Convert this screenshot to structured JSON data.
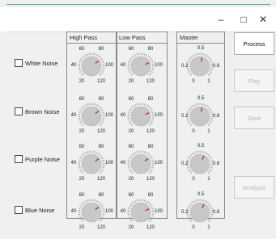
{
  "window": {
    "controls": {
      "minimize": "–",
      "maximize": "□",
      "close": "✕"
    }
  },
  "groups": {
    "highpass": "High Pass",
    "lowpass": "Low Pass",
    "master": "Master"
  },
  "noises": [
    {
      "label": "White Noise",
      "checked": false
    },
    {
      "label": "Brown Noise",
      "checked": false
    },
    {
      "label": "Purple Noise",
      "checked": false
    },
    {
      "label": "Blue Noise",
      "checked": false
    }
  ],
  "freq_ticks": {
    "a": "60",
    "b": "80",
    "c": "40",
    "d": "100",
    "e": "20",
    "f": "120"
  },
  "master_ticks": {
    "a": "0.5",
    "b": "0.2",
    "c": "0.8",
    "d": "0",
    "e": "1"
  },
  "knob_values": {
    "highpass": [
      90,
      90,
      90,
      90
    ],
    "lowpass": [
      95,
      95,
      90,
      95
    ],
    "master": [
      0.55,
      0.55,
      0.6,
      0.6
    ]
  },
  "buttons": {
    "process": "Process",
    "play": "Play",
    "save": "Save",
    "analysis": "Analysis"
  },
  "colors": {
    "pointer": "#c0392b",
    "knob_face": "#c8c8c8",
    "knob_ticks": "#8a9aa6"
  }
}
